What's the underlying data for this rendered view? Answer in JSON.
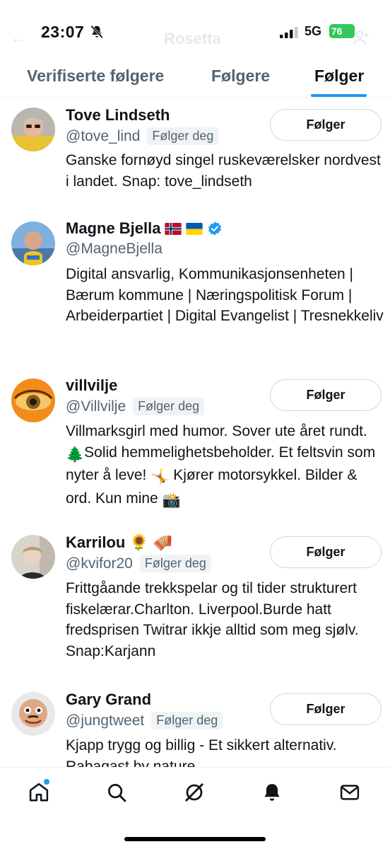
{
  "status_bar": {
    "time": "23:07",
    "network": "5G",
    "battery": "76",
    "faded_title": "Rosetta"
  },
  "tabs": [
    {
      "label": "Verifiserte følgere",
      "active": false
    },
    {
      "label": "Følgere",
      "active": false
    },
    {
      "label": "Følger",
      "active": true
    }
  ],
  "users": [
    {
      "name": "Tove Lindseth",
      "handle": "@tove_lind",
      "follows_you": "Følger deg",
      "button": "Følger",
      "bio": "Ganske fornøyd singel ruskeværelsker nordvest i landet. Snap: tove_lindseth"
    },
    {
      "name": "Magne Bjella",
      "handle": "@MagneBjella",
      "verified": true,
      "bio": "Digital ansvarlig, Kommunikasjonsenheten | Bærum kommune | Næringspolitisk Forum | Arbeiderpartiet | Digital Evangelist | Tresnekkeliv"
    },
    {
      "name": "villvilje",
      "handle": "@Villvilje",
      "follows_you": "Følger deg",
      "button": "Følger",
      "bio_parts": [
        "Villmarksgirl med humor. Sover ute året rundt. ",
        "🌲",
        "Solid hemmelighetsbeholder. Et feltsvin som nyter å leve! ",
        "🤸",
        " Kjører motorsykkel. Bilder & ord. Kun mine ",
        "📸"
      ]
    },
    {
      "name": "Karrilou",
      "name_emojis": [
        "🌻",
        "🪗"
      ],
      "handle": "@kvifor20",
      "follows_you": "Følger deg",
      "button": "Følger",
      "bio": "Frittgåande trekkspelar og til tider strukturert fiskelærar.Charlton. Liverpool.Burde hatt fredsprisen Twitrar ikkje alltid som meg sjølv. Snap:Karjann"
    },
    {
      "name": "Gary Grand",
      "handle": "@jungtweet",
      "follows_you": "Følger deg",
      "button": "Følger",
      "bio": "Kjapp trygg og billig - Et sikkert alternativ. Rabagast by nature"
    }
  ],
  "nav": [
    "home-icon",
    "search-icon",
    "grok-icon",
    "notifications-icon",
    "messages-icon"
  ]
}
